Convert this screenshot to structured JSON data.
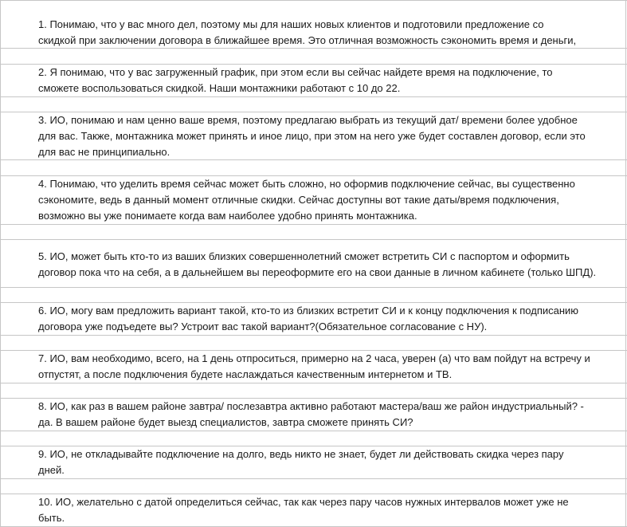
{
  "items": [
    {
      "lines": [
        "1.    Понимаю, что у вас много дел, поэтому мы для наших новых клиентов и подготовили предложение со",
        "скидкой при заключении договора в ближайшее время. Это отличная возможность сэкономить время и деньги,"
      ]
    },
    {
      "lines": [
        "2.    Я понимаю, что у вас загруженный график, при этом если вы сейчас найдете время на подключение, то",
        "сможете воспользоваться скидкой. Наши монтажники работают с 10 до 22."
      ]
    },
    {
      "lines": [
        "3.    ИО, понимаю и нам ценно ваше время, поэтому предлагаю выбрать из текущий дат/ времени более удобное",
        "для вас. Также, монтажника может принять и иное лицо, при этом на него уже будет составлен договор, если это",
        "для вас не принципиально."
      ]
    },
    {
      "lines": [
        "4.    Понимаю, что уделить время сейчас может быть сложно, но оформив подключение сейчас, вы существенно",
        "сэкономите, ведь в данный момент отличные скидки. Сейчас доступны вот такие даты/время подключения,",
        "возможно вы уже понимаете когда вам наиболее удобно принять монтажника."
      ]
    },
    {
      "lines": [
        "5.    ИО, может быть кто-то из ваших близких совершеннолетний сможет встретить СИ с паспортом и оформить",
        "договор пока что на себя, а в дальнейшем вы переоформите его на свои данные в личном кабинете (только ШПД)."
      ]
    },
    {
      "lines": [
        "6.    ИО, могу вам предложить вариант такой, кто-то из близких встретит СИ и к концу подключения к подписанию",
        "договора уже подъедете вы? Устроит вас такой вариант?(Обязательное согласование с НУ)."
      ]
    },
    {
      "lines": [
        "7.    ИО, вам необходимо, всего, на 1 день отпроситься, примерно на 2 часа, уверен (а) что вам пойдут на встречу и",
        "отпустят, а после подключения будете наслаждаться качественным интернетом и ТВ."
      ]
    },
    {
      "lines": [
        "8.    ИО, как раз в вашем районе завтра/ послезавтра активно работают мастера/ваш же район индустриальный? -",
        "да.   В вашем районе  будет выезд специалистов, завтра сможете принять СИ?"
      ]
    },
    {
      "lines": [
        "9.    ИО, не откладывайте подключение на долго, ведь никто не знает, будет ли действовать скидка через пару",
        "дней."
      ]
    },
    {
      "lines": [
        "10.  ИО,  желательно с датой определиться сейчас, так как через пару часов нужных интервалов может уже не",
        "быть."
      ]
    }
  ]
}
